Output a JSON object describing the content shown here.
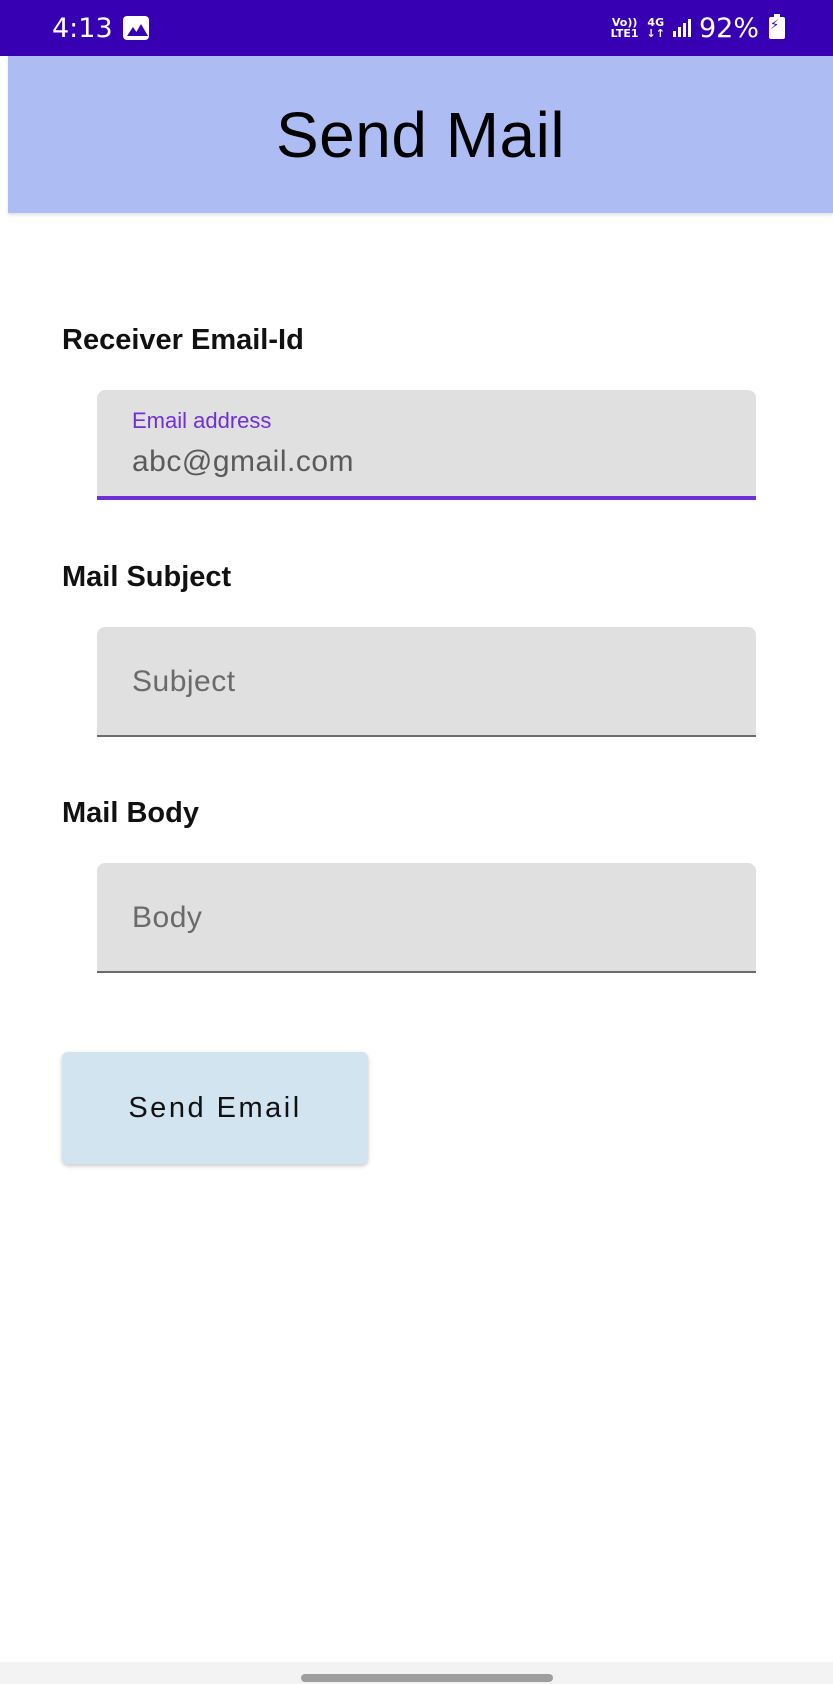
{
  "status_bar": {
    "time": "4:13",
    "volte_top": "Vo))",
    "volte_bottom": "LTE1",
    "network_top": "4G",
    "network_bottom": "↓↑",
    "battery_percent": "92%",
    "icons": [
      "gallery-icon",
      "signal-icon",
      "battery-charging-icon"
    ]
  },
  "app_bar": {
    "title": "Send Mail"
  },
  "form": {
    "receiver": {
      "section_label": "Receiver Email-Id",
      "floating_label": "Email address",
      "value": "abc@gmail.com"
    },
    "subject": {
      "section_label": "Mail Subject",
      "placeholder": "Subject"
    },
    "body": {
      "section_label": "Mail Body",
      "placeholder": "Body"
    },
    "send_button_label": "Send Email"
  },
  "colors": {
    "status_bar": "#3700b3",
    "app_bar": "#adbcf3",
    "focus_accent": "#6f2fd6",
    "button_bg": "#d1e4f0",
    "field_bg": "#e0e0e0"
  }
}
